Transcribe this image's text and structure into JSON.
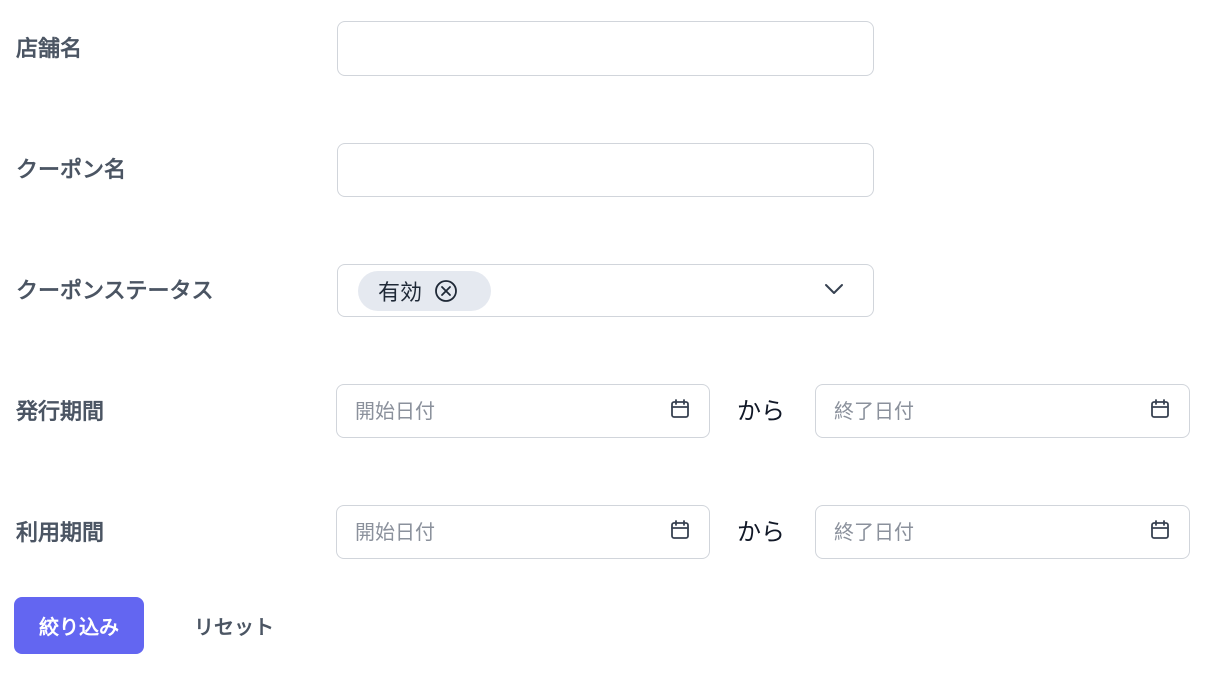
{
  "form": {
    "store_name": {
      "label": "店舗名",
      "value": ""
    },
    "coupon_name": {
      "label": "クーポン名",
      "value": ""
    },
    "coupon_status": {
      "label": "クーポンステータス",
      "selected_chip": "有効"
    },
    "issue_period": {
      "label": "発行期間",
      "start_placeholder": "開始日付",
      "separator": "から",
      "end_placeholder": "終了日付"
    },
    "usage_period": {
      "label": "利用期間",
      "start_placeholder": "開始日付",
      "separator": "から",
      "end_placeholder": "終了日付"
    }
  },
  "actions": {
    "filter_label": "絞り込み",
    "reset_label": "リセット"
  },
  "colors": {
    "primary": "#6366f1",
    "chip_bg": "#e5e9f0",
    "border": "#d1d5db"
  },
  "icons": {
    "date": "calendar-icon",
    "dropdown": "chevron-down-icon",
    "chip_remove": "close-circle-icon"
  }
}
